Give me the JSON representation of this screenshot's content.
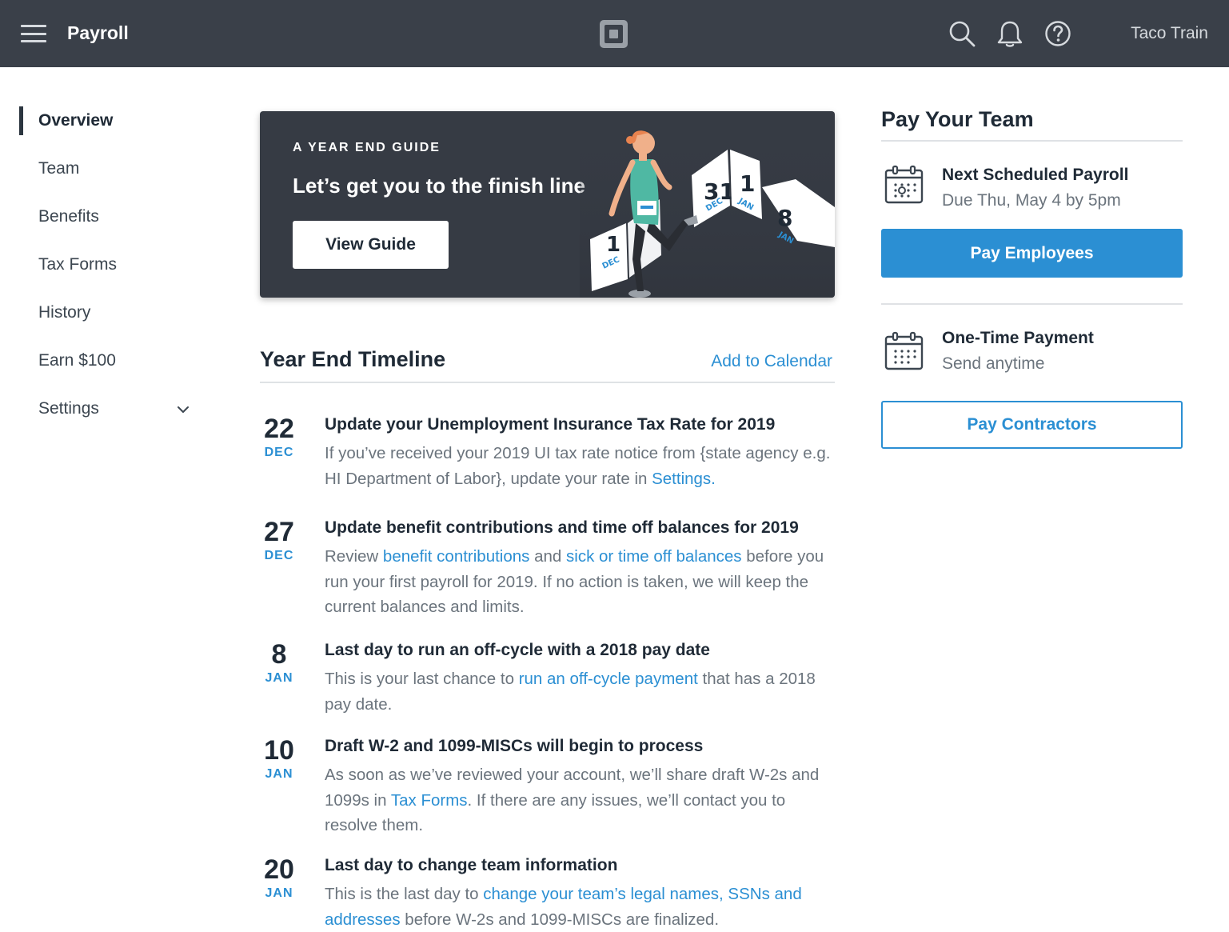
{
  "header": {
    "menu_icon": "hamburger-menu-icon",
    "title": "Payroll",
    "logo_icon": "square-logo-icon",
    "icons": [
      "search-icon",
      "bell-icon",
      "help-icon"
    ],
    "user": "Taco Train"
  },
  "sidebar": {
    "items": [
      {
        "label": "Overview",
        "active": true
      },
      {
        "label": "Team"
      },
      {
        "label": "Benefits"
      },
      {
        "label": "Tax Forms"
      },
      {
        "label": "History"
      },
      {
        "label": "Earn $100"
      },
      {
        "label": "Settings",
        "icon": "chevron-down-icon"
      }
    ]
  },
  "banner": {
    "kicker": "A YEAR END GUIDE",
    "title": "Let’s get you to the finish line",
    "button": "View Guide",
    "calendar_cards": [
      {
        "day": "1",
        "month": "DEC"
      },
      {
        "day": "31",
        "month": "DEC"
      },
      {
        "day": "1",
        "month": "JAN"
      },
      {
        "day": "8",
        "month": "JAN"
      }
    ]
  },
  "timeline": {
    "title": "Year End Timeline",
    "add_to_calendar": "Add to Calendar",
    "items": [
      {
        "day": "22",
        "month": "DEC",
        "title": "Update your Unemployment Insurance Tax Rate for 2019",
        "body": {
          "t1": "If you’ve received your 2019 UI tax rate notice from {state agency e.g. HI Department of Labor}, update your rate in ",
          "l1": "Settings.",
          "t2": ""
        }
      },
      {
        "day": "27",
        "month": "DEC",
        "title": "Update benefit contributions and time off balances for 2019",
        "body": {
          "t1": "Review ",
          "l1": "benefit contributions",
          "t2": " and ",
          "l2": "sick or time off balances",
          "t3": " before you run your first payroll for 2019. If no action is taken, we will keep the current balances and limits."
        }
      },
      {
        "day": "8",
        "month": "JAN",
        "title": "Last day to run an off-cycle with a 2018 pay date",
        "body": {
          "t1": "This is your last chance to ",
          "l1": "run an off-cycle payment",
          "t2": " that has a 2018 pay date."
        }
      },
      {
        "day": "10",
        "month": "JAN",
        "title": "Draft W-2 and 1099-MISCs will begin to process",
        "body": {
          "t1": "As soon as we’ve reviewed your account, we’ll share draft W-2s and 1099s in ",
          "l1": "Tax Forms",
          "t2": ". If there are any issues, we’ll contact you to resolve them."
        }
      },
      {
        "day": "20",
        "month": "JAN",
        "title": "Last day to change team information",
        "body": {
          "t1": "This is the last day to ",
          "l1": "change your team’s legal names, SSNs and addresses",
          "t2": " before W-2s and 1099-MISCs are finalized."
        }
      }
    ]
  },
  "pay_team": {
    "title": "Pay Your Team",
    "scheduled": {
      "icon": "calendar-scheduled-icon",
      "title": "Next Scheduled Payroll",
      "subtitle": "Due Thu, May 4 by 5pm",
      "button": "Pay Employees"
    },
    "one_time": {
      "icon": "calendar-icon",
      "title": "One-Time Payment",
      "subtitle": "Send anytime",
      "button": "Pay Contractors"
    }
  },
  "colors": {
    "topbar": "#3a4049",
    "accent": "#2b8fd3",
    "banner": "#363b44",
    "text_dark": "#1f2a36",
    "text_muted": "#6b747d"
  }
}
